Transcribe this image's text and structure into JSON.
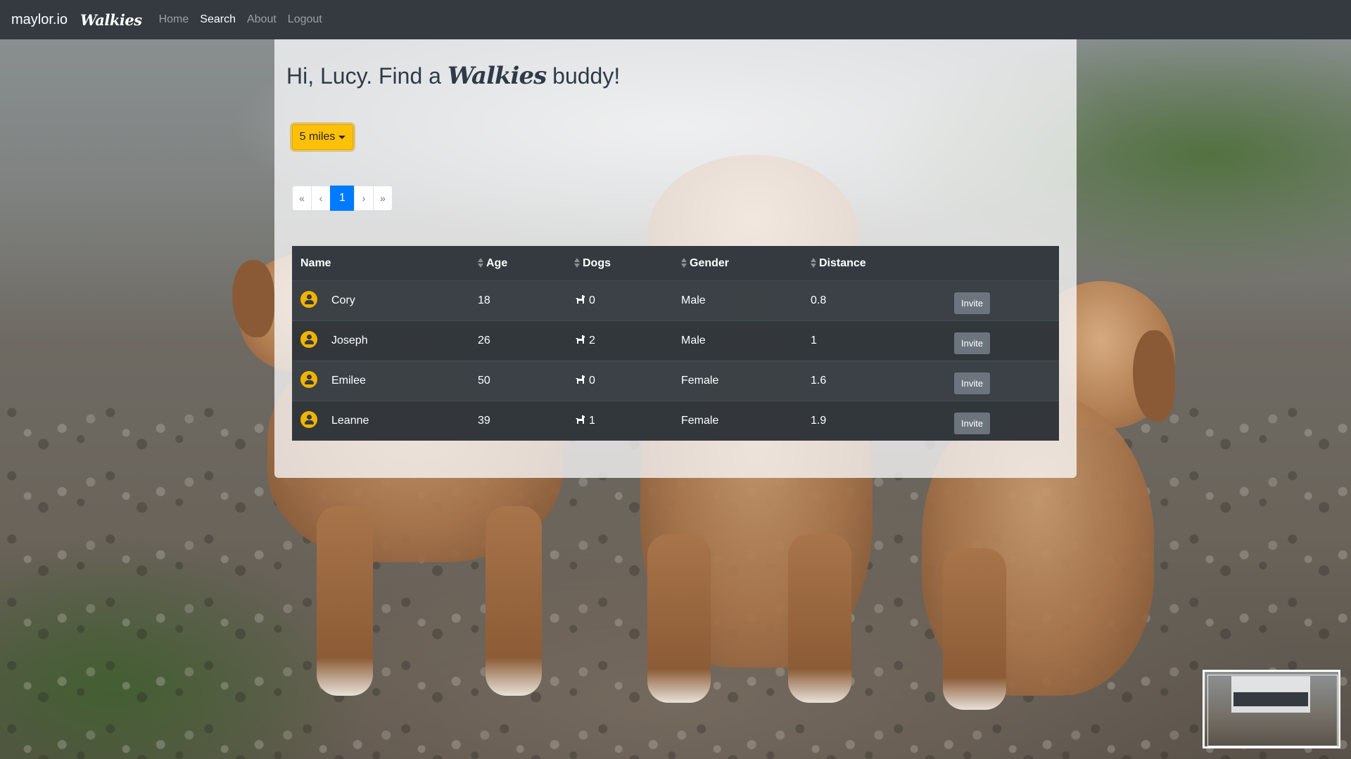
{
  "navbar": {
    "brand": "maylor.io",
    "logo": "Walkies",
    "links": [
      {
        "label": "Home",
        "active": false
      },
      {
        "label": "Search",
        "active": true
      },
      {
        "label": "About",
        "active": false
      },
      {
        "label": "Logout",
        "active": false
      }
    ]
  },
  "heading": {
    "prefix": "Hi, Lucy. Find a",
    "brand_word": "Walkies",
    "suffix": "buddy!"
  },
  "distance_filter": {
    "selected": "5 miles"
  },
  "pagination": {
    "first": "«",
    "prev": "‹",
    "current": "1",
    "next": "›",
    "last": "»"
  },
  "table": {
    "columns": [
      "Name",
      "Age",
      "Dogs",
      "Gender",
      "Distance"
    ],
    "rows": [
      {
        "name": "Cory",
        "age": "18",
        "dogs": "0",
        "gender": "Male",
        "distance": "0.8",
        "action": "Invite"
      },
      {
        "name": "Joseph",
        "age": "26",
        "dogs": "2",
        "gender": "Male",
        "distance": "1",
        "action": "Invite"
      },
      {
        "name": "Emilee",
        "age": "50",
        "dogs": "0",
        "gender": "Female",
        "distance": "1.6",
        "action": "Invite"
      },
      {
        "name": "Leanne",
        "age": "39",
        "dogs": "1",
        "gender": "Female",
        "distance": "1.9",
        "action": "Invite"
      }
    ]
  },
  "icons": {
    "avatar": "user-circle-icon",
    "dog": "dog-icon",
    "sort": "sort-icon",
    "caret": "caret-down-icon"
  },
  "colors": {
    "navbar": "#343a40",
    "warning": "#ffc107",
    "primary": "#007bff",
    "secondary": "#6c757d",
    "avatar": "#f0b400"
  }
}
